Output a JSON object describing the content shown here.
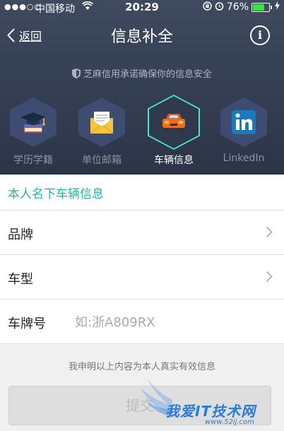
{
  "status_bar": {
    "signal_dots": "●●●○○",
    "carrier": "中国移动",
    "time": "20:29",
    "battery_percent": "76%",
    "battery_level": 0.76
  },
  "nav": {
    "back_label": "返回",
    "title": "信息补全"
  },
  "promise_text": "芝麻信用承诺确保你的信息安全",
  "categories": [
    {
      "label": "学历学籍",
      "icon": "graduation-cap-icon"
    },
    {
      "label": "单位邮箱",
      "icon": "envelope-icon"
    },
    {
      "label": "车辆信息",
      "icon": "car-icon",
      "active": true
    },
    {
      "label": "LinkedIn",
      "icon": "linkedin-icon"
    }
  ],
  "section_title": "本人名下车辆信息",
  "form": {
    "brand_label": "品牌",
    "model_label": "车型",
    "plate_label": "车牌号",
    "plate_placeholder": "如:浙A809RX",
    "plate_value": ""
  },
  "declaration": "我申明以上内容为本人真实有效信息",
  "submit_label": "提交",
  "watermark": {
    "text": "我爱IT技术网",
    "url": "www.52ij.com"
  },
  "colors": {
    "accent": "#1fb89e",
    "header_bg": "#3f4a5f",
    "active_outline": "#46e8c8"
  }
}
